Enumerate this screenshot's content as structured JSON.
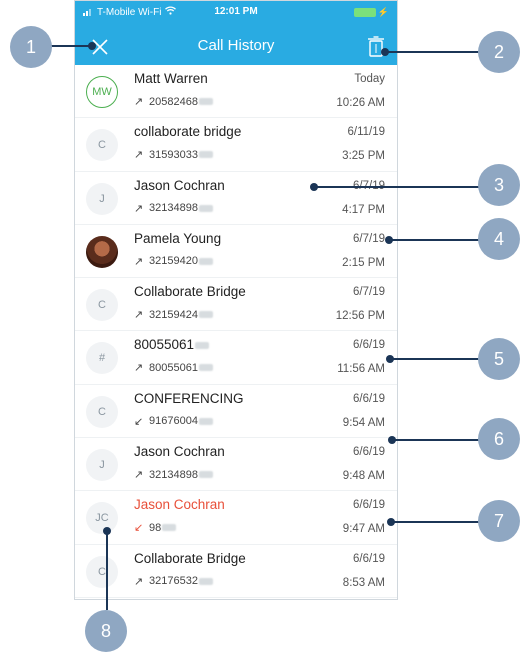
{
  "status_bar": {
    "carrier": "T-Mobile Wi-Fi",
    "time": "12:01 PM"
  },
  "header": {
    "title": "Call History"
  },
  "calls": [
    {
      "avatar": "MW",
      "name": "Matt Warren",
      "number": "20582468",
      "direction": "outgoing",
      "date": "Today",
      "time": "10:26 AM"
    },
    {
      "avatar": "C",
      "name": "collaborate bridge",
      "number": "31593033",
      "direction": "outgoing",
      "date": "6/11/19",
      "time": "3:25 PM"
    },
    {
      "avatar": "J",
      "name": "Jason Cochran",
      "number": "32134898",
      "direction": "outgoing",
      "date": "6/7/19",
      "time": "4:17 PM"
    },
    {
      "avatar": "",
      "name": "Pamela Young",
      "number": "32159420",
      "direction": "outgoing",
      "date": "6/7/19",
      "time": "2:15 PM"
    },
    {
      "avatar": "C",
      "name": "Collaborate Bridge",
      "number": "32159424",
      "direction": "outgoing",
      "date": "6/7/19",
      "time": "12:56 PM"
    },
    {
      "avatar": "#",
      "name": "80055061",
      "number": "80055061",
      "direction": "outgoing",
      "date": "6/6/19",
      "time": "11:56 AM"
    },
    {
      "avatar": "C",
      "name": "CONFERENCING",
      "number": "91676004",
      "direction": "incoming",
      "date": "6/6/19",
      "time": "9:54 AM"
    },
    {
      "avatar": "J",
      "name": "Jason Cochran",
      "number": "32134898",
      "direction": "outgoing",
      "date": "6/6/19",
      "time": "9:48 AM"
    },
    {
      "avatar": "JC",
      "name": "Jason Cochran",
      "number": "98",
      "direction": "missed",
      "date": "6/6/19",
      "time": "9:47 AM"
    },
    {
      "avatar": "C",
      "name": "Collaborate Bridge",
      "number": "32176532",
      "direction": "outgoing",
      "date": "6/6/19",
      "time": "8:53 AM"
    }
  ],
  "callouts": [
    "1",
    "2",
    "3",
    "4",
    "5",
    "6",
    "7",
    "8"
  ],
  "colors": {
    "header": "#29abe2",
    "missed": "#e8503a",
    "callout": "#8fa7c2",
    "leader": "#1b3556"
  }
}
